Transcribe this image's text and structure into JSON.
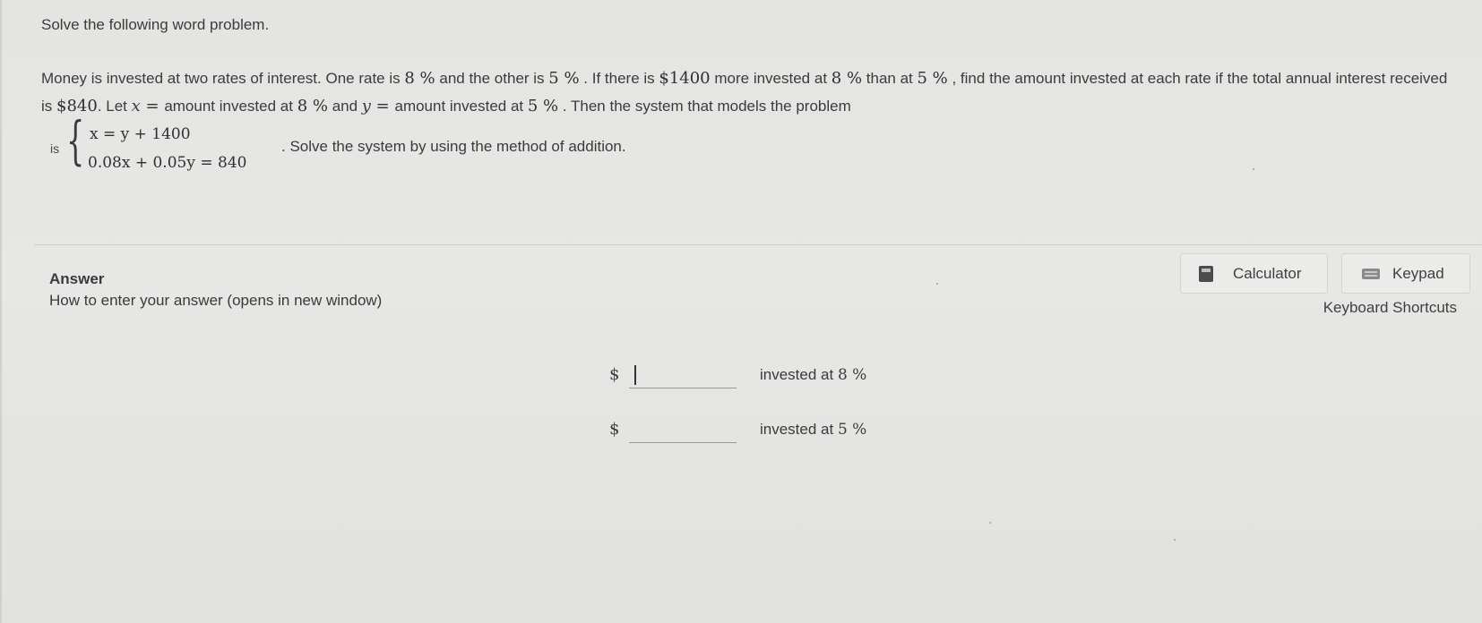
{
  "question": {
    "instruction": "Solve the following word problem.",
    "text_1": "Money is invested at two rates of interest.  One rate is ",
    "rate_1": "8 %",
    "text_2": "  and the other is ",
    "rate_2": "5 %",
    "text_3": " .  If there is ",
    "difference": "$1400",
    "text_4": " more invested at ",
    "rate_1b": "8 %",
    "text_5": "  than at ",
    "rate_2b": "5 %",
    "text_6": " , find the amount invested at each rate if the total annual interest received is ",
    "total_interest": "$840",
    "text_7": ".  Let ",
    "var_x": "x",
    "equals": " = ",
    "text_8": " amount invested at ",
    "rate_1c": "8 %",
    "text_9": "  and ",
    "var_y": "y",
    "text_10": " amount invested at ",
    "rate_2c": "5 %",
    "text_11": " .  Then the system that models the problem",
    "system_prefix": "is",
    "equation_1": "x = y + 1400",
    "equation_2": "0.08x + 0.05y = 840",
    "system_suffix": ".  Solve the system by using the method of addition."
  },
  "answer": {
    "title": "Answer",
    "help_link": "How to enter your answer (opens in new window)",
    "calculator_label": "Calculator",
    "keypad_label": "Keypad",
    "shortcuts_label": "Keyboard Shortcuts",
    "fields": [
      {
        "prefix": "$",
        "value": "",
        "suffix_text": "invested at ",
        "suffix_rate": "8 %"
      },
      {
        "prefix": "$",
        "value": "",
        "suffix_text": "invested at ",
        "suffix_rate": "5 %"
      }
    ]
  },
  "icons": {
    "calculator": "calculator-icon",
    "keypad": "keyboard-icon"
  }
}
